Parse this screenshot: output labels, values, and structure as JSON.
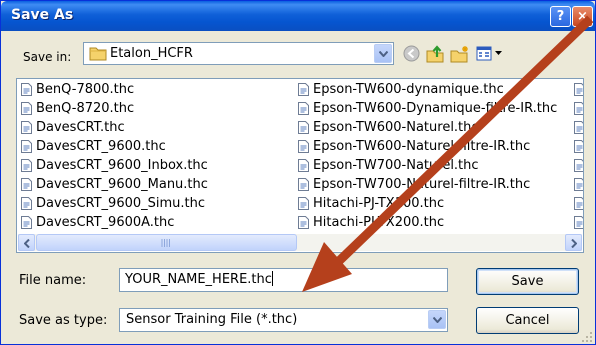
{
  "window": {
    "title": "Save As",
    "help_label": "?",
    "close_label": "×"
  },
  "save_in": {
    "label": "Save in:",
    "value": "Etalon_HCFR"
  },
  "toolbar_icons": [
    "back-icon",
    "up-folder-icon",
    "new-folder-icon",
    "view-menu-icon"
  ],
  "file_list": {
    "column1": [
      "BenQ-7800.thc",
      "BenQ-8720.thc",
      "DavesCRT.thc",
      "DavesCRT_9600.thc",
      "DavesCRT_9600_Inbox.thc",
      "DavesCRT_9600_Manu.thc",
      "DavesCRT_9600_Simu.thc",
      "DavesCRT_9600A.thc"
    ],
    "column2": [
      "Epson-TW600-dynamique.thc",
      "Epson-TW600-Dynamique-filtre-IR.thc",
      "Epson-TW600-Naturel.thc",
      "Epson-TW600-Naturel-filtre-IR.thc",
      "Epson-TW700-Naturel.thc",
      "Epson-TW700-Naturel-filtre-IR.thc",
      "Hitachi-PJ-TX100.thc",
      "Hitachi-PJ-TX200.thc"
    ]
  },
  "file_name": {
    "label": "File name:",
    "value": "YOUR_NAME_HERE.thc"
  },
  "save_as_type": {
    "label": "Save as type:",
    "value": "Sensor Training File (*.thc)"
  },
  "buttons": {
    "save": "Save",
    "cancel": "Cancel"
  },
  "colors": {
    "title_bar": "#0a5fe0",
    "dialog_bg": "#ece9d8",
    "arrow": "#b5401c"
  }
}
